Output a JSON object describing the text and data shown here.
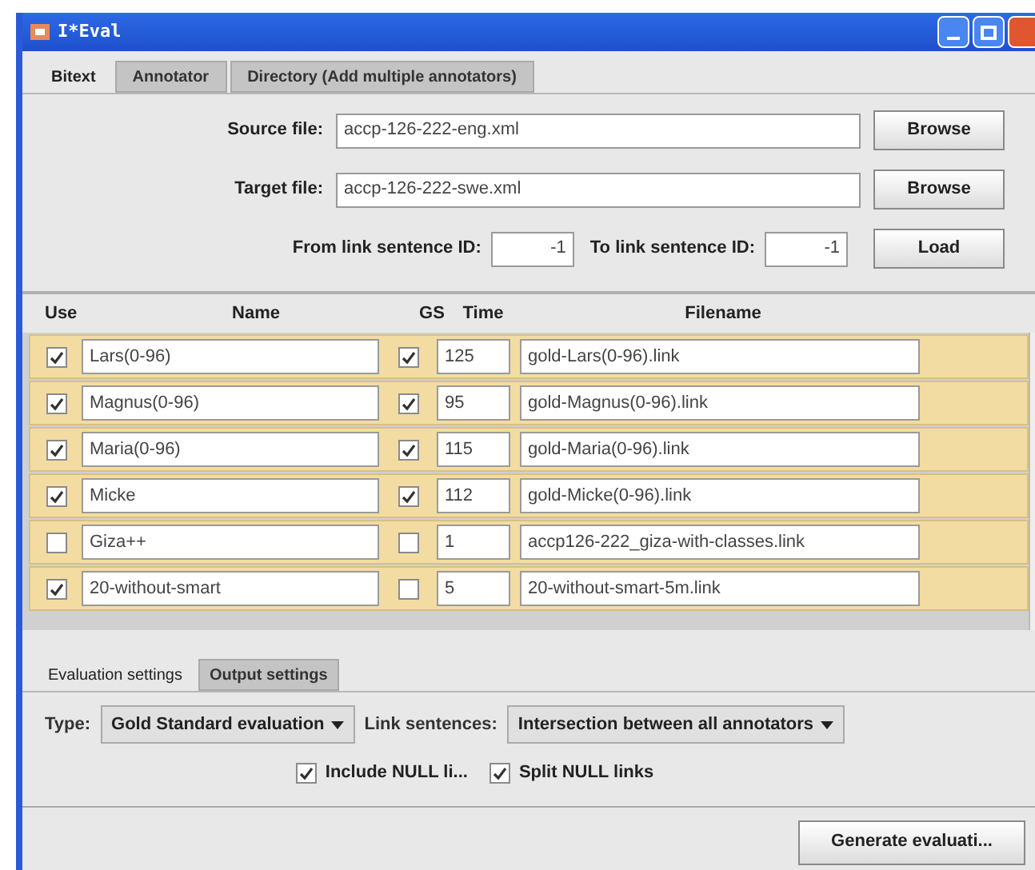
{
  "window": {
    "title": "I*Eval"
  },
  "tabs": [
    {
      "label": "Bitext",
      "selected": true
    },
    {
      "label": "Annotator",
      "selected": false
    },
    {
      "label": "Directory (Add multiple annotators)",
      "selected": false
    }
  ],
  "form": {
    "source_label": "Source file:",
    "source_value": "accp-126-222-eng.xml",
    "source_button": "Browse",
    "target_label": "Target file:",
    "target_value": "accp-126-222-swe.xml",
    "target_button": "Browse",
    "from_label": "From link sentence ID:",
    "from_value": "-1",
    "to_label": "To link sentence ID:",
    "to_value": "-1",
    "load_button": "Load"
  },
  "table": {
    "columns": [
      "Use",
      "Name",
      "GS",
      "Time",
      "Filename"
    ],
    "rows": [
      {
        "use": true,
        "name": "Lars(0-96)",
        "gs": true,
        "time": "125",
        "filename": "gold-Lars(0-96).link"
      },
      {
        "use": true,
        "name": "Magnus(0-96)",
        "gs": true,
        "time": "95",
        "filename": "gold-Magnus(0-96).link"
      },
      {
        "use": true,
        "name": "Maria(0-96)",
        "gs": true,
        "time": "115",
        "filename": "gold-Maria(0-96).link"
      },
      {
        "use": true,
        "name": "Micke",
        "gs": true,
        "time": "112",
        "filename": "gold-Micke(0-96).link"
      },
      {
        "use": false,
        "name": "Giza++",
        "gs": false,
        "time": "1",
        "filename": "accp126-222_giza-with-classes.link"
      },
      {
        "use": true,
        "name": "20-without-smart",
        "gs": false,
        "time": "5",
        "filename": "20-without-smart-5m.link"
      }
    ]
  },
  "settings_tabs": [
    {
      "label": "Evaluation settings",
      "selected": true
    },
    {
      "label": "Output settings",
      "selected": false
    }
  ],
  "settings": {
    "type_label": "Type:",
    "type_value": "Gold Standard evaluation",
    "link_label": "Link sentences:",
    "link_value": "Intersection between all annotators",
    "options": [
      {
        "label": "Include NULL li...",
        "checked": true
      },
      {
        "label": "Split NULL links",
        "checked": true
      }
    ],
    "generate_button": "Generate evaluati..."
  }
}
